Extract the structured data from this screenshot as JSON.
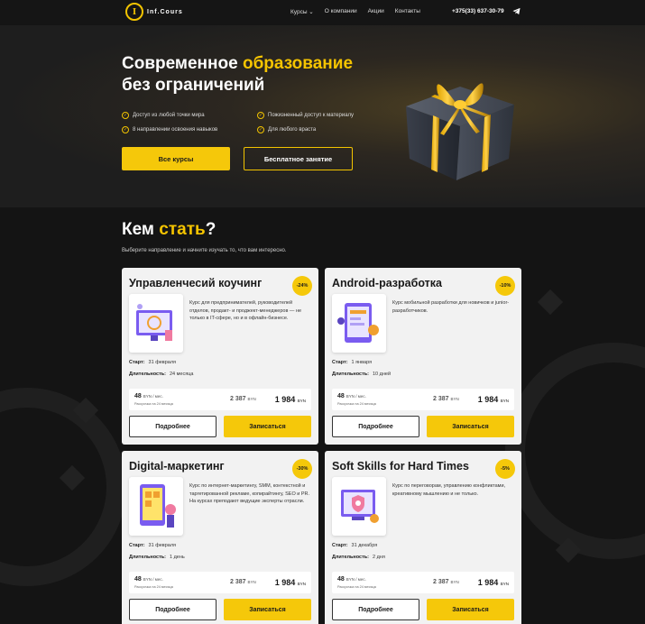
{
  "header": {
    "logo_mark": "I",
    "logo_text": "Inf.Cours",
    "nav": [
      "Курсы ⌄",
      "О компании",
      "Акции",
      "Контакты"
    ],
    "phone": "+375(33) 637-30-79",
    "telegram_icon": "telegram-icon"
  },
  "hero": {
    "title_part1": "Современное ",
    "title_accent": "образование",
    "title_line2": "без ограничений",
    "features": [
      "Доступ из любой точки мира",
      "Пожизненный доступ к материалу",
      "8 направлении освоения навыков",
      "Для любого враста"
    ],
    "btn_courses": "Все курсы",
    "btn_free": "Бесплатное занятие",
    "accent_color": "#f5c400"
  },
  "section": {
    "title_part1": "Кем ",
    "title_accent": "стать",
    "title_end": "?",
    "subtitle": "Выберите направление и начните изучать то, что вам интересно."
  },
  "labels": {
    "start": "Старт:",
    "duration": "Длительность:",
    "installment": "Рассрочка на 24 месяца",
    "currency": "BYN",
    "per_month": "BYN / мес.",
    "more": "Подробнее",
    "enroll": "Записаться"
  },
  "cards": [
    {
      "title": "Управленчесий коучинг",
      "discount": "-24%",
      "description": "Курс для предпринимателей, руководителей отделов, продакт- и проджект-менеджеров — не только в IT-сфере, но и в офлайн-бизнесе.",
      "start": "31 февраля",
      "duration": "24 месяца",
      "monthly": "48",
      "old_price": "2 387",
      "new_price": "1 984"
    },
    {
      "title": "Android-разработка",
      "discount": "-10%",
      "description": "Курс мобильной разработки для новичков и junior-разработчиков.",
      "start": "1 января",
      "duration": "10 дней",
      "monthly": "48",
      "old_price": "2 387",
      "new_price": "1 984"
    },
    {
      "title": "Digital-маркетинг",
      "discount": "-30%",
      "description": "Курс по интернет-маркетингу, SMM, контекстной и таргетированной рекламе, копирайтингу, SEO и PR. На курсах преподают ведущие эксперты отрасли.",
      "start": "31 февраля",
      "duration": "1 день",
      "monthly": "48",
      "old_price": "2 387",
      "new_price": "1 984"
    },
    {
      "title": "Soft Skills for Hard Times",
      "discount": "-5%",
      "description": "Курс по переговорам, управлению конфликтами, креативному мышлению и не только.",
      "start": "31 декабря",
      "duration": "2 дня",
      "monthly": "48",
      "old_price": "2 387",
      "new_price": "1 984"
    }
  ]
}
